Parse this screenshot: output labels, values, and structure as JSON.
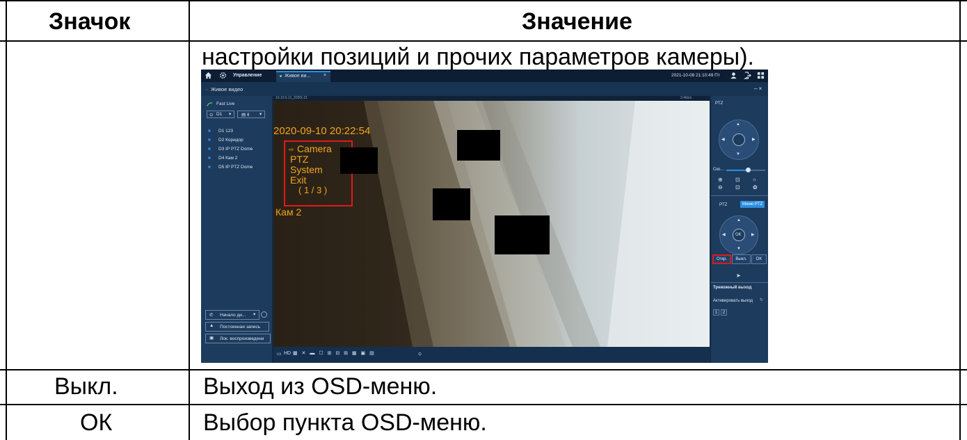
{
  "table": {
    "header_icon": "Значок",
    "header_value": "Значение",
    "row1_value_text": "настройки позиций и прочих параметров камеры).",
    "row2_icon": "Выкл.",
    "row2_value": "Выход из OSD-меню.",
    "row3_icon": "ОК",
    "row3_value": "Выбор пункта OSD-меню."
  },
  "screenshot": {
    "topbar": {
      "home_icon": "home-icon",
      "settings_icon": "gear-icon",
      "management_tab": "Управление",
      "live_tab": "Живое ви...",
      "datetime": "2021-10-08 21:10:49 Пт",
      "user_icon": "user-icon",
      "logout_icon": "logout-icon",
      "grid_icon": "grid-icon"
    },
    "subbar": {
      "title": "Живое видео",
      "window_controls": "– ×"
    },
    "left": {
      "fast_live": "Fast Live",
      "d1_selector": "D1",
      "channels": [
        "D1 123",
        "D2 Коридор",
        "D3 IP PTZ Dome",
        "D4 Кам 2",
        "D5 IP PTZ Dome"
      ],
      "start_talk": "Начало ди...",
      "constant_record": "Постоянная запись",
      "local_playback": "Лок. воспроизведени"
    },
    "video": {
      "header_left": "10.10.6.11_2020(-21",
      "header_right": "3.4kb/s",
      "timestamp": "2020-09-10 20:22:54",
      "osd_menu": [
        "Camera",
        "PTZ",
        "System",
        "Exit",
        "( 1 / 3 )"
      ],
      "camera_name": "Кам 2"
    },
    "bottombar": {
      "hd_label": "HD"
    },
    "right": {
      "ptz_title": "PTZ",
      "speed_label": "Ско...",
      "tab_ptz": "PTZ",
      "tab_menu_ptz": "Меню PTZ",
      "ok_label": "OK",
      "open_button": "Откр.",
      "off_button": "Выкл.",
      "ok_button": "OK",
      "alarm_output": "Тревожный выход",
      "activate_output": "Активировать выход",
      "output_1": "1",
      "output_2": "2"
    },
    "colors": {
      "osd_text": "#f2a51f",
      "highlight_red": "#e01a1a",
      "accent_blue": "#2a8fe0"
    }
  }
}
